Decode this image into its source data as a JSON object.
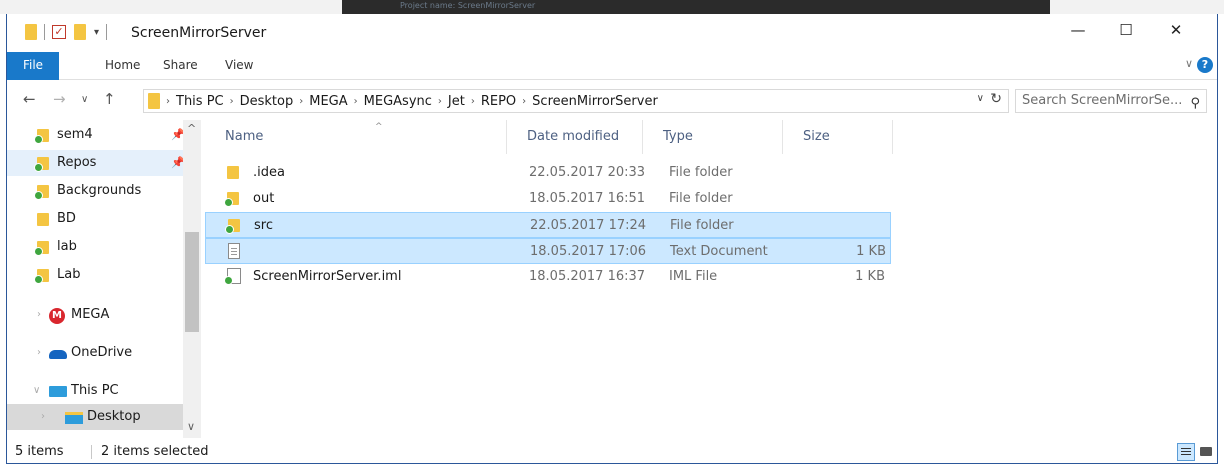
{
  "background": {
    "dim_tag": "Project name:   ScreenMirrorServer"
  },
  "window": {
    "title": "ScreenMirrorServer",
    "minimize": "—",
    "maximize": "☐",
    "close": "✕"
  },
  "ribbon": {
    "tabs": [
      "File",
      "Home",
      "Share",
      "View"
    ],
    "help": "?"
  },
  "address": {
    "crumbs": [
      "This PC",
      "Desktop",
      "MEGA",
      "MEGAsync",
      "Jet",
      "REPO",
      "ScreenMirrorServer"
    ],
    "search_placeholder": "Search ScreenMirrorSe..."
  },
  "nav": {
    "items": [
      {
        "label": "sem4",
        "pinned": true
      },
      {
        "label": "Repos",
        "pinned": true
      },
      {
        "label": "Backgrounds"
      },
      {
        "label": "BD"
      },
      {
        "label": "lab"
      },
      {
        "label": "Lab"
      }
    ],
    "groups": [
      {
        "label": "MEGA"
      },
      {
        "label": "OneDrive"
      },
      {
        "label": "This PC"
      },
      {
        "label": "Desktop"
      }
    ]
  },
  "columns": {
    "name": "Name",
    "date": "Date modified",
    "type": "Type",
    "size": "Size"
  },
  "files": [
    {
      "name": ".idea",
      "date": "22.05.2017 20:33",
      "type": "File folder",
      "size": ""
    },
    {
      "name": "out",
      "date": "18.05.2017 16:51",
      "type": "File folder",
      "size": ""
    },
    {
      "name": "src",
      "date": "22.05.2017 17:24",
      "type": "File folder",
      "size": ""
    },
    {
      "name": "",
      "date": "18.05.2017 17:06",
      "type": "Text Document",
      "size": "1 KB"
    },
    {
      "name": "ScreenMirrorServer.iml",
      "date": "18.05.2017 16:37",
      "type": "IML File",
      "size": "1 KB"
    }
  ],
  "status": {
    "count": "5 items",
    "selected": "2 items selected"
  },
  "colors": {
    "accent": "#1979ca",
    "selection": "#cce8ff",
    "folder": "#f4c542",
    "sync": "#3fa63f"
  }
}
